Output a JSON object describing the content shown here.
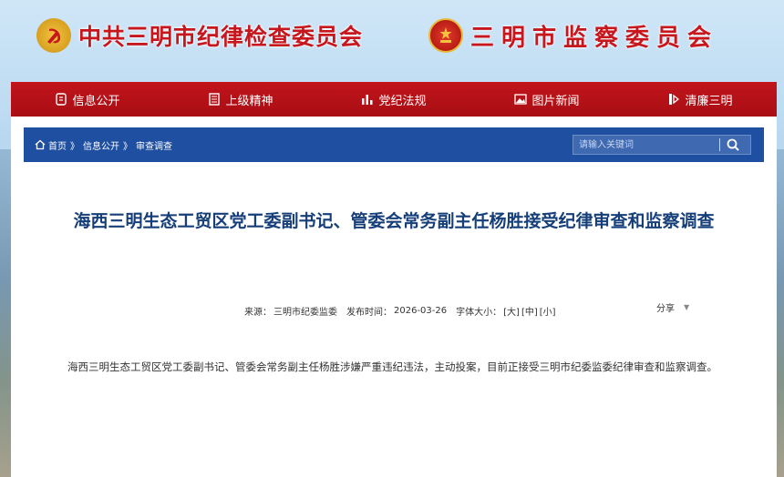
{
  "header": {
    "left_title": "中共三明市纪律检查委员会",
    "right_title": "三明市监察委员会",
    "left_emblem": "party-emblem-icon",
    "right_emblem": "national-emblem-icon"
  },
  "nav": [
    {
      "label": "信息公开",
      "icon": "document-icon"
    },
    {
      "label": "上级精神",
      "icon": "book-icon"
    },
    {
      "label": "党纪法规",
      "icon": "bar-chart-icon"
    },
    {
      "label": "图片新闻",
      "icon": "image-icon"
    },
    {
      "label": "清廉三明",
      "icon": "lotus-icon"
    }
  ],
  "breadcrumb": {
    "home": "首页",
    "level1": "信息公开",
    "level2": "审查调查",
    "separator": "》"
  },
  "search": {
    "placeholder": "请输入关键词"
  },
  "article": {
    "title": "海西三明生态工贸区党工委副书记、管委会常务副主任杨胜接受纪律审查和监察调查",
    "source_label": "来源：",
    "source": "三明市纪委监委",
    "date_label": "发布时间：",
    "date": "2026-03-26",
    "font_label": "字体大小：",
    "size_large": "[大]",
    "size_medium": "[中]",
    "size_small": "[小]",
    "share": "分享",
    "body": "海西三明生态工贸区党工委副书记、管委会常务副主任杨胜涉嫌严重违纪违法，主动投案，目前正接受三明市纪委监委纪律审查和监察调查。"
  },
  "colors": {
    "nav_red": "#c2141b",
    "crumb_blue": "#1f4fa0",
    "title_blue": "#163f7a",
    "brand_red": "#c8161d"
  }
}
